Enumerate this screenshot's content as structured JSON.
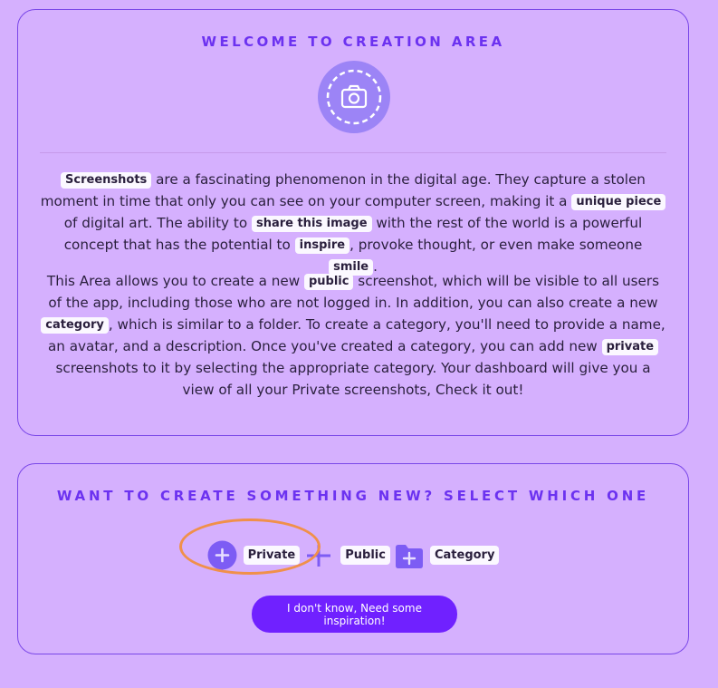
{
  "creation_area": {
    "title": "WELCOME TO CREATION AREA",
    "icon": "camera-icon",
    "paragraph1": [
      {
        "tag": "Screenshots"
      },
      {
        "text": " are a fascinating phenomenon in the digital age. They capture a stolen moment in time that only you can see on your computer screen, making it a "
      },
      {
        "tag": "unique piece"
      },
      {
        "text": " of digital art. The ability to "
      },
      {
        "tag": "share this image"
      },
      {
        "text": " with the rest of the world is a powerful concept that has the potential to "
      },
      {
        "tag": "inspire"
      },
      {
        "text": ", provoke thought, or even make someone "
      },
      {
        "tag": "smile"
      },
      {
        "text": "."
      }
    ],
    "paragraph2": [
      {
        "text": "This Area allows you to create a new "
      },
      {
        "tag": "public"
      },
      {
        "text": " screenshot, which will be visible to all users of the app, including those who are not logged in. In addition, you can also create a new "
      },
      {
        "tag": "category"
      },
      {
        "text": ", which is similar to a folder. To create a category, you'll need to provide a name, an avatar, and a description. Once you've created a category, you can add new "
      },
      {
        "tag": "private"
      },
      {
        "text": " screenshots to it by selecting the appropriate category. Your dashboard will give you a view of all your Private screenshots, Check it out!"
      }
    ]
  },
  "create_new": {
    "title": "WANT TO CREATE SOMETHING NEW? SELECT WHICH ONE",
    "options": [
      {
        "label": "Private",
        "icon": "plus-circle-icon"
      },
      {
        "label": "Public",
        "icon": "plus-icon"
      },
      {
        "label": "Category",
        "icon": "folder-plus-icon"
      }
    ],
    "inspire_button": "I don't know, Need some inspiration!"
  },
  "colors": {
    "background": "#d5b0fe",
    "accent": "#6c32f0",
    "button": "#7021ff",
    "highlight": "#f0904a"
  }
}
